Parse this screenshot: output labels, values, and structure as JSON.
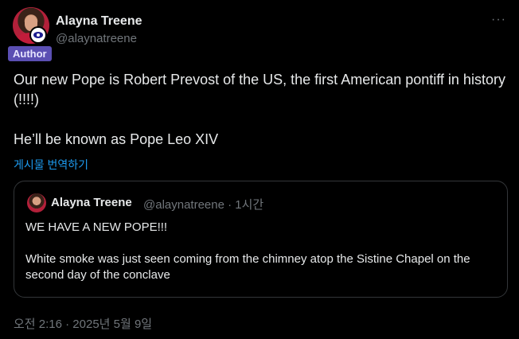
{
  "author": {
    "name": "Alayna Treene",
    "handle": "@alaynatreene",
    "badge": "Author"
  },
  "menu": {
    "more_icon": "···"
  },
  "tweet": {
    "text": "Our new Pope is Robert Prevost of the US, the first American pontiff in history (!!!!)\n\nHe’ll be known as Pope Leo XIV",
    "translate_label": "게시물 번역하기",
    "timestamp": "오전 2:16 · 2025년 5월 9일"
  },
  "quote": {
    "name": "Alayna Treene",
    "meta": "@alaynatreene · 1시간",
    "text": "WE HAVE A NEW POPE!!!\n\nWhite smoke was just seen coming from the chimney atop the Sistine Chapel on the second day of the conclave"
  },
  "colors": {
    "background": "#000000",
    "text": "#e7e9ea",
    "muted": "#71767b",
    "link": "#1d9bf0",
    "author_badge": "#5b4fb3"
  }
}
